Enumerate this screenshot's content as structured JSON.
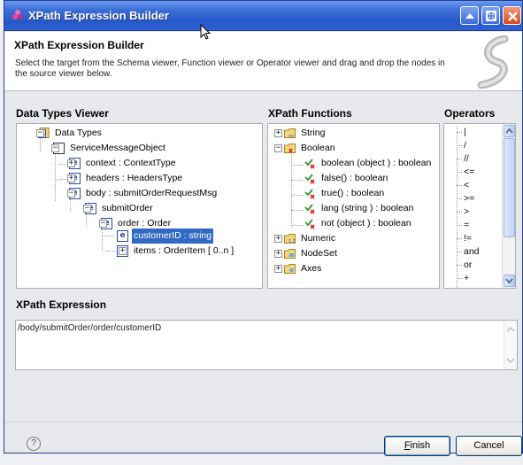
{
  "window": {
    "title": "XPath Expression Builder"
  },
  "header": {
    "title": "XPath Expression Builder",
    "description": "Select the target from the Schema viewer, Function viewer or Operator viewer and drag and drop the nodes in the source viewer below."
  },
  "data_types": {
    "title": "Data Types Viewer",
    "nodes": [
      {
        "label": "Data Types",
        "icon": "data-types-icon",
        "expanded": true
      },
      {
        "label": "ServiceMessageObject",
        "icon": "smo-icon",
        "expanded": true
      },
      {
        "label": "context : ContextType",
        "icon": "element-icon",
        "expanded": false
      },
      {
        "label": "headers : HeadersType",
        "icon": "element-icon",
        "expanded": false
      },
      {
        "label": "body : submitOrderRequestMsg",
        "icon": "element-icon",
        "expanded": true
      },
      {
        "label": "submitOrder",
        "icon": "element-icon",
        "expanded": true
      },
      {
        "label": "order : Order",
        "icon": "element-icon",
        "expanded": true
      },
      {
        "label": "customerID : string",
        "icon": "element-icon",
        "selected": true
      },
      {
        "label": "items : OrderItem [ 0..n ]",
        "icon": "element-icon",
        "expanded": false
      }
    ]
  },
  "functions": {
    "title": "XPath Functions",
    "nodes": [
      {
        "label": "String",
        "icon": "folder-icon",
        "expanded": false
      },
      {
        "label": "Boolean",
        "icon": "folder-icon",
        "expanded": true
      },
      {
        "label": "boolean (object ) : boolean",
        "icon": "function-icon"
      },
      {
        "label": "false() : boolean",
        "icon": "function-icon"
      },
      {
        "label": "true() : boolean",
        "icon": "function-icon"
      },
      {
        "label": "lang (string ) : boolean",
        "icon": "function-icon"
      },
      {
        "label": "not (object ) : boolean",
        "icon": "function-icon"
      },
      {
        "label": "Numeric",
        "icon": "folder-icon",
        "expanded": false
      },
      {
        "label": "NodeSet",
        "icon": "folder-icon",
        "expanded": false
      },
      {
        "label": "Axes",
        "icon": "folder-icon",
        "expanded": false
      }
    ]
  },
  "operators": {
    "title": "Operators",
    "items": [
      "|",
      "/",
      "//",
      "<=",
      "<",
      ">=",
      ">",
      "=",
      "!=",
      "and",
      "or",
      "+"
    ]
  },
  "expression": {
    "title": "XPath Expression",
    "value": "/body/submitOrder/order/customerID"
  },
  "buttons": {
    "finish": "Finish",
    "cancel": "Cancel",
    "help": "?"
  },
  "colors": {
    "titlebar": "#2757c9",
    "selection": "#316ac5"
  }
}
